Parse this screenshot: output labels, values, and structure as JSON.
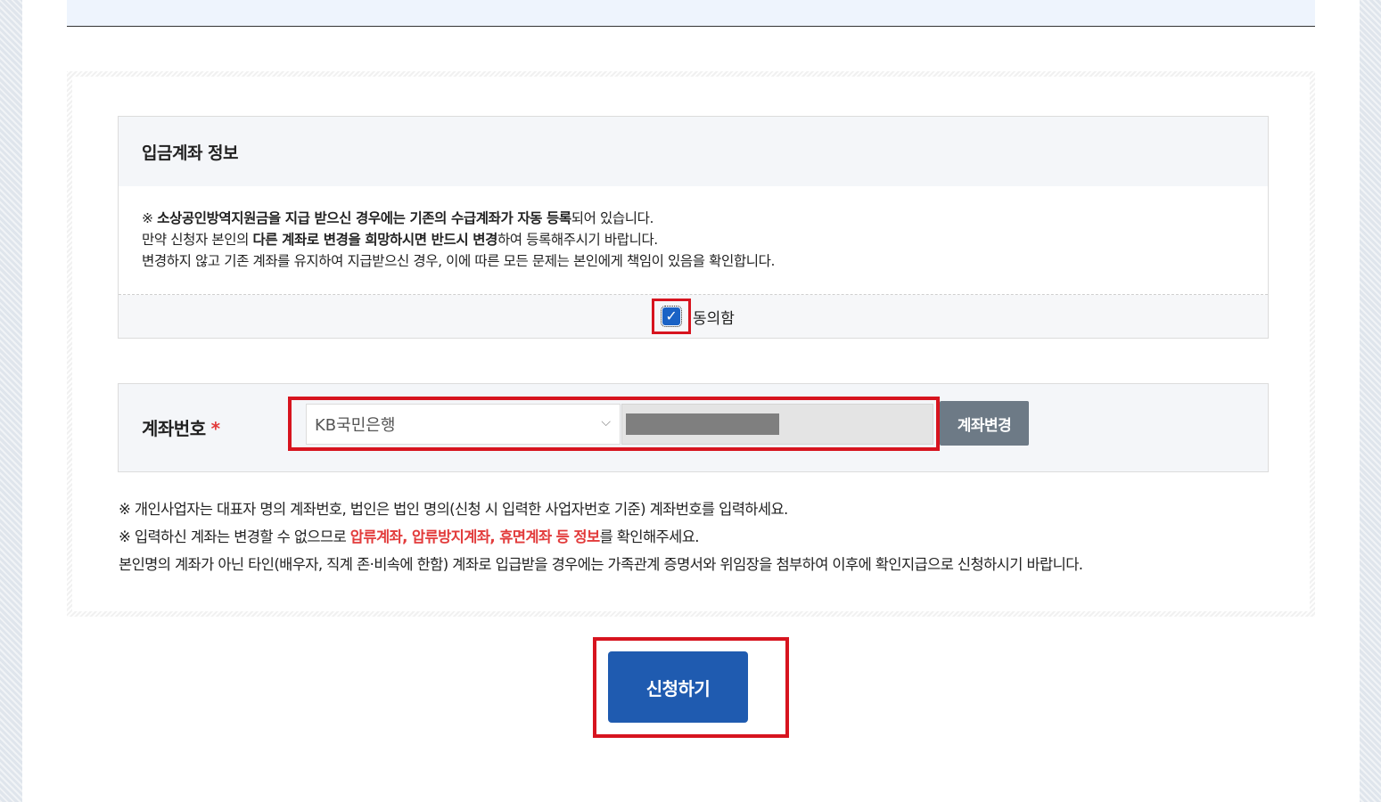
{
  "info_panel": {
    "title": "입금계좌 정보",
    "line1": {
      "prefix": "※ ",
      "bold": "소상공인방역지원금을 지급 받으신 경우에는 기존의 수급계좌가 자동 등록",
      "suffix": "되어 있습니다."
    },
    "line2": {
      "prefix": "만약 신청자 본인의 ",
      "bold": "다른 계좌로 변경을 희망하시면 반드시 변경",
      "suffix": "하여 등록해주시기 바랍니다."
    },
    "line3": "변경하지 않고 기존 계좌를 유지하여 지급받으신 경우, 이에 따른 모든 문제는 본인에게 책임이 있음을 확인합니다.",
    "agree_label": "동의함",
    "agree_checked": true
  },
  "account": {
    "label": "계좌번호",
    "required_mark": "*",
    "bank_selected": "KB국민은행",
    "change_button": "계좌변경"
  },
  "notes": {
    "line1": "※ 개인사업자는 대표자 명의 계좌번호, 법인은 법인 명의(신청 시 입력한 사업자번호 기준) 계좌번호를 입력하세요.",
    "line2_prefix": "※ 입력하신 계좌는 변경할 수 없으므로 ",
    "line2_red": "압류계좌, 압류방지계좌, 휴면계좌 등 정보",
    "line2_suffix": "를 확인해주세요.",
    "line3": "본인명의 계좌가 아닌 타인(배우자, 직계 존·비속에 한함) 계좌로 입급받을 경우에는 가족관계 증명서와 위임장을 첨부하여 이후에 확인지급으로 신청하시기 바랍니다."
  },
  "submit_button": "신청하기",
  "colors": {
    "highlight_red": "#d7141f",
    "primary_blue": "#1f5bb0",
    "warning_red": "#e23b3b"
  }
}
